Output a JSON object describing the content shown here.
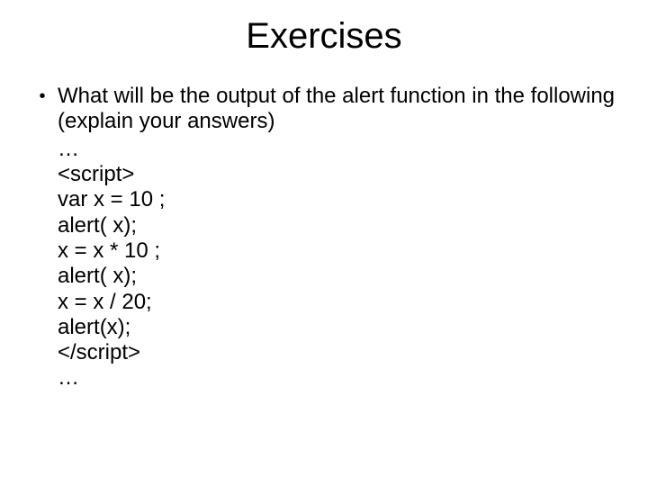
{
  "title": "Exercises",
  "bullet_text": "What will be the output of the alert function in the following (explain your answers)",
  "code_lines": {
    "l0": "…",
    "l1": "<script>",
    "l2": "var x = 10 ;",
    "l3": "alert( x);",
    "l4": "x = x * 10 ;",
    "l5": "alert( x);",
    "l6": "x = x / 20;",
    "l7": "alert(x);",
    "l8": "</script>",
    "l9": "…"
  }
}
